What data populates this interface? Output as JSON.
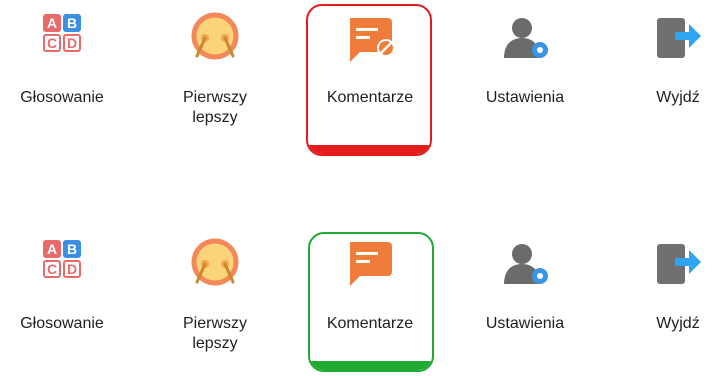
{
  "rows": [
    {
      "state": "selected-red",
      "items": [
        {
          "label": "Głosowanie",
          "icon": "abcd-voting-icon"
        },
        {
          "label": "Pierwszy\nlepszy",
          "icon": "buzzer-face-icon"
        },
        {
          "label": "Komentarze",
          "icon": "comment-blocked-icon"
        },
        {
          "label": "Ustawienia",
          "icon": "user-settings-icon"
        },
        {
          "label": "Wyjdź",
          "icon": "exit-door-icon"
        }
      ]
    },
    {
      "state": "selected-green",
      "items": [
        {
          "label": "Głosowanie",
          "icon": "abcd-voting-icon"
        },
        {
          "label": "Pierwszy\nlepszy",
          "icon": "buzzer-face-icon"
        },
        {
          "label": "Komentarze",
          "icon": "comment-icon"
        },
        {
          "label": "Ustawienia",
          "icon": "user-settings-icon"
        },
        {
          "label": "Wyjdź",
          "icon": "exit-door-icon"
        }
      ]
    }
  ],
  "abc_letters": [
    "A",
    "B",
    "C",
    "D"
  ],
  "colors": {
    "red_highlight": "#e21b1b",
    "green_highlight": "#1faa34",
    "comment_orange": "#f07c3c",
    "settings_gray": "#6b6b6b",
    "settings_gear_blue": "#3a95e6",
    "exit_arrow_blue": "#2fa4f0"
  }
}
